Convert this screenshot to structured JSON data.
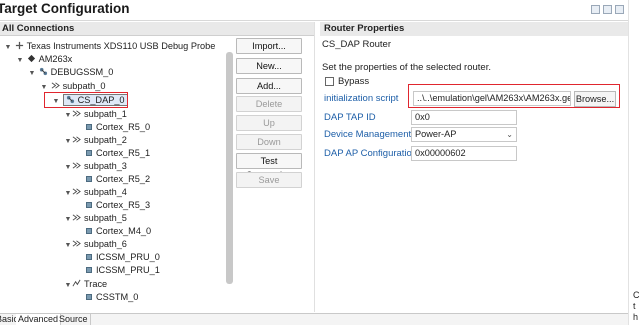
{
  "title": "Target Configuration",
  "connections_header": "All Connections",
  "tree": {
    "nodes": [
      {
        "label": "Texas Instruments XDS110 USB Debug Probe",
        "icon": "probe-icon"
      },
      {
        "label": "AM263x",
        "icon": "device-icon"
      },
      {
        "label": "DEBUGSSM_0",
        "icon": "router-icon"
      },
      {
        "label": "subpath_0",
        "icon": "subpath-icon"
      },
      {
        "label": "CS_DAP_0",
        "icon": "router-icon"
      },
      {
        "label": "subpath_1",
        "icon": "subpath-icon"
      },
      {
        "label": "Cortex_R5_0",
        "icon": "cpu-icon"
      },
      {
        "label": "subpath_2",
        "icon": "subpath-icon"
      },
      {
        "label": "Cortex_R5_1",
        "icon": "cpu-icon"
      },
      {
        "label": "subpath_3",
        "icon": "subpath-icon"
      },
      {
        "label": "Cortex_R5_2",
        "icon": "cpu-icon"
      },
      {
        "label": "subpath_4",
        "icon": "subpath-icon"
      },
      {
        "label": "Cortex_R5_3",
        "icon": "cpu-icon"
      },
      {
        "label": "subpath_5",
        "icon": "subpath-icon"
      },
      {
        "label": "Cortex_M4_0",
        "icon": "cpu-icon"
      },
      {
        "label": "subpath_6",
        "icon": "subpath-icon"
      },
      {
        "label": "ICSSM_PRU_0",
        "icon": "cpu-icon"
      },
      {
        "label": "ICSSM_PRU_1",
        "icon": "cpu-icon"
      },
      {
        "label": "Trace",
        "icon": "trace-icon"
      },
      {
        "label": "CSSTM_0",
        "icon": "cpu-icon"
      }
    ]
  },
  "buttons": {
    "import": "Import...",
    "new": "New...",
    "add": "Add...",
    "delete": "Delete",
    "up": "Up",
    "down": "Down",
    "test_connection": "Test Connection",
    "save": "Save"
  },
  "router_properties": {
    "header": "Router Properties",
    "name": "CS_DAP Router",
    "instruction": "Set the properties of the selected router.",
    "bypass_label": "Bypass",
    "bypass_checked": false,
    "init_script_label": "initialization script",
    "init_script_value": "..\\..\\emulation\\gel\\AM263x\\AM263x.gel",
    "browse_label": "Browse...",
    "dap_tap_id_label": "DAP TAP ID",
    "dap_tap_id_value": "0x0",
    "device_management_label": "Device Management",
    "device_management_value": "Power-AP",
    "dap_ap_config_label": "DAP AP Configuration",
    "dap_ap_config_value": "0x00000602"
  },
  "tabs": [
    "Basic",
    "Advanced",
    "Source"
  ],
  "active_tab": "Advanced",
  "right_edge_text": [
    "C",
    "t",
    "h"
  ],
  "colors": {
    "label_blue": "#1e5fa8",
    "highlight_red": "#e0262e",
    "selection_bg": "#dfe9f7"
  }
}
